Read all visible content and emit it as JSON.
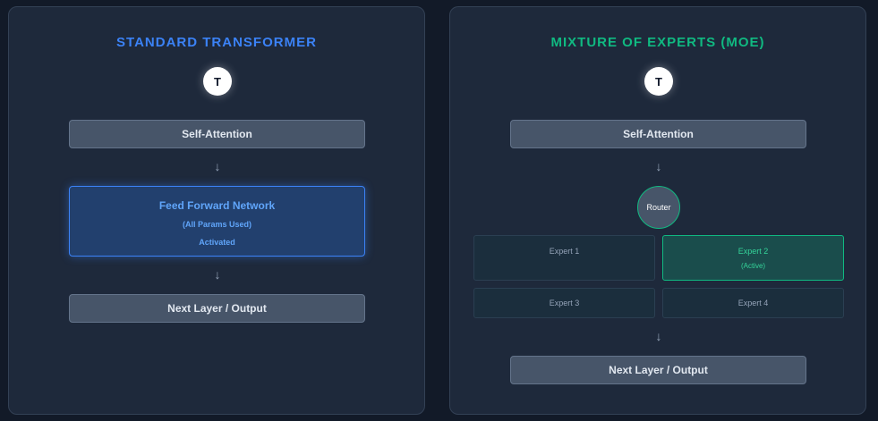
{
  "standard": {
    "title": "STANDARD TRANSFORMER",
    "token": "T",
    "attention": "Self-Attention",
    "arrow": "↓",
    "ffn": {
      "title": "Feed Forward Network",
      "subtitle": "(All Params Used)",
      "status": "Activated"
    },
    "output": "Next Layer / Output"
  },
  "moe": {
    "title": "MIXTURE OF EXPERTS (MOE)",
    "token": "T",
    "attention": "Self-Attention",
    "arrow": "↓",
    "router": "Router",
    "experts": [
      {
        "label": "Expert 1",
        "status": "",
        "active": false
      },
      {
        "label": "Expert 2",
        "status": "(Active)",
        "active": true
      },
      {
        "label": "Expert 3",
        "status": "",
        "active": false
      },
      {
        "label": "Expert 4",
        "status": "",
        "active": false
      }
    ],
    "output": "Next Layer / Output"
  },
  "colors": {
    "standard_accent": "#3b82f6",
    "moe_accent": "#10b981",
    "background": "#121a28",
    "panel": "#1e293b"
  }
}
